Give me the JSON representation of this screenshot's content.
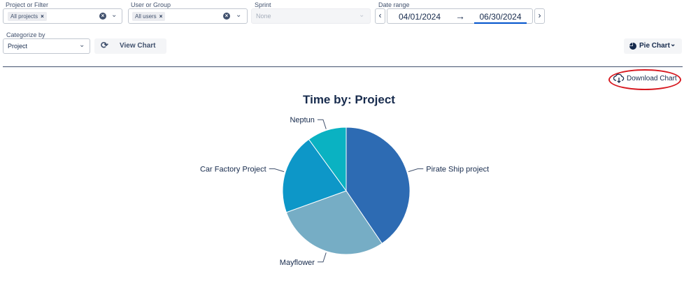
{
  "filters": {
    "project": {
      "label": "Project or Filter",
      "tag": "All projects"
    },
    "user": {
      "label": "User or Group",
      "tag": "All users"
    },
    "sprint": {
      "label": "Sprint",
      "placeholder": "None"
    },
    "date_range": {
      "label": "Date range",
      "from": "04/01/2024",
      "to": "06/30/2024"
    }
  },
  "categorize": {
    "label": "Categorize by",
    "value": "Project"
  },
  "view_chart_label": "View Chart",
  "chart_type_label": "Pie Chart",
  "download_label": "Download Chart",
  "colors": {
    "accent": "#0052cc",
    "highlight_circle": "#d71920"
  },
  "chart_data": {
    "type": "pie",
    "title": "Time by: Project",
    "slices": [
      {
        "label": "Pirate Ship project",
        "value": 40.5,
        "color": "#2d6bb3"
      },
      {
        "label": "Mayflower",
        "value": 29,
        "color": "#76adc5"
      },
      {
        "label": "Car Factory Project",
        "value": 20.5,
        "color": "#0d97c8"
      },
      {
        "label": "Neptun",
        "value": 10,
        "color": "#0ab2c2"
      }
    ]
  }
}
